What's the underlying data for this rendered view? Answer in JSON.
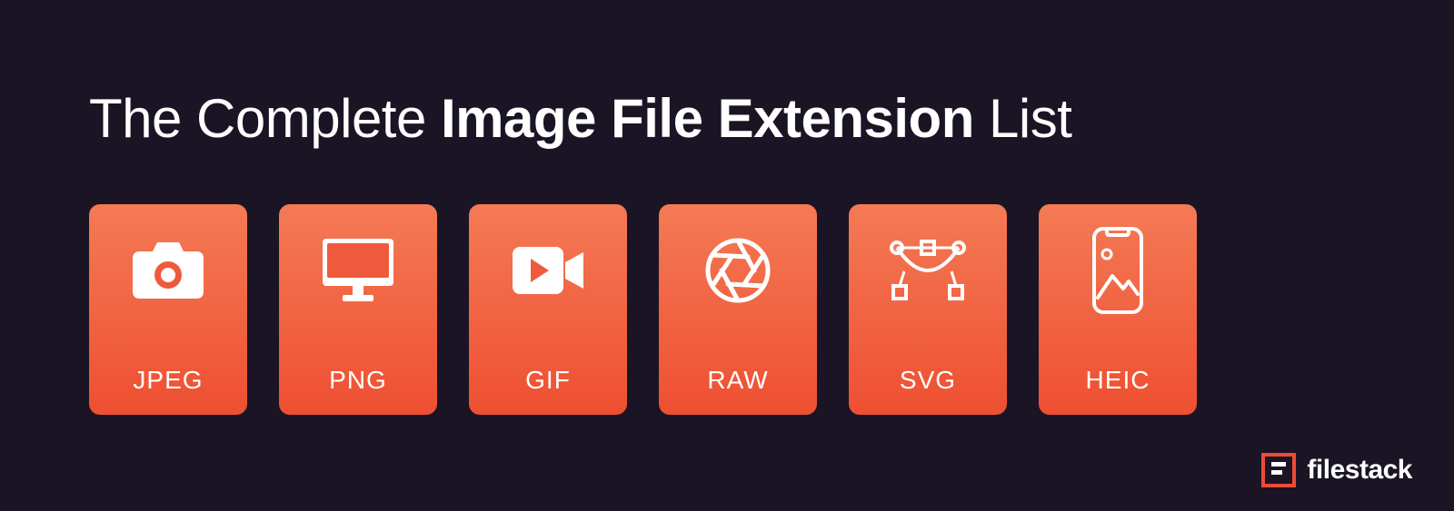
{
  "title": {
    "prefix": "The Complete ",
    "bold": "Image File Extension",
    "suffix": " List"
  },
  "cards": [
    {
      "label": "JPEG",
      "icon": "camera-icon"
    },
    {
      "label": "PNG",
      "icon": "monitor-icon"
    },
    {
      "label": "GIF",
      "icon": "video-icon"
    },
    {
      "label": "RAW",
      "icon": "aperture-icon"
    },
    {
      "label": "SVG",
      "icon": "vector-icon"
    },
    {
      "label": "HEIC",
      "icon": "phone-image-icon"
    }
  ],
  "brand": {
    "name": "filestack"
  },
  "colors": {
    "background": "#1a1425",
    "card_top": "#f47a55",
    "card_bottom": "#ee4f31",
    "text": "#ffffff",
    "brand_accent": "#ef4b33"
  }
}
